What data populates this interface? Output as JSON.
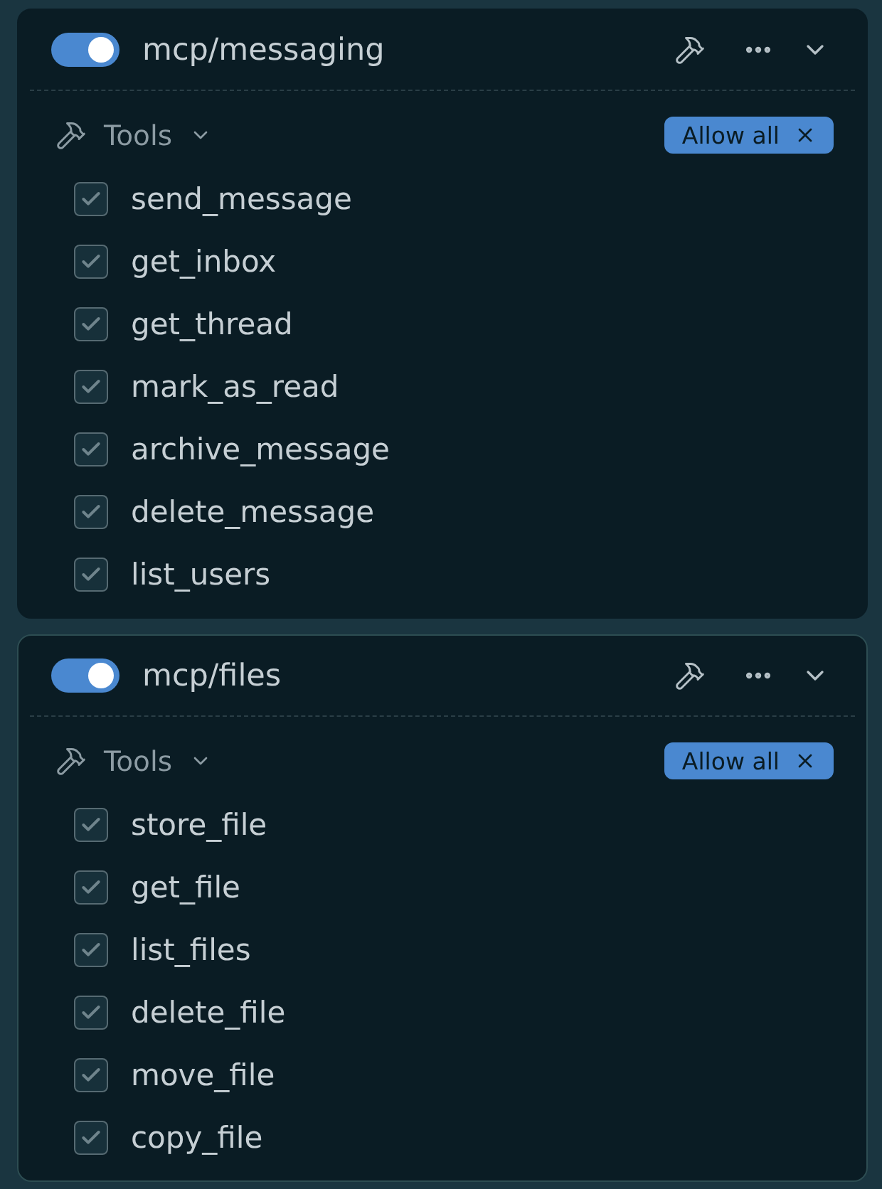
{
  "servers": [
    {
      "name": "mcp/messaging",
      "enabled": true,
      "highlighted": false,
      "expanded": true,
      "tools_label": "Tools",
      "tools_expanded": true,
      "allow_all": "Allow all",
      "tools": [
        {
          "name": "send_message",
          "checked": true
        },
        {
          "name": "get_inbox",
          "checked": true
        },
        {
          "name": "get_thread",
          "checked": true
        },
        {
          "name": "mark_as_read",
          "checked": true
        },
        {
          "name": "archive_message",
          "checked": true
        },
        {
          "name": "delete_message",
          "checked": true
        },
        {
          "name": "list_users",
          "checked": true
        }
      ]
    },
    {
      "name": "mcp/files",
      "enabled": true,
      "highlighted": true,
      "expanded": true,
      "tools_label": "Tools",
      "tools_expanded": true,
      "allow_all": "Allow all",
      "tools": [
        {
          "name": "store_file",
          "checked": true
        },
        {
          "name": "get_file",
          "checked": true
        },
        {
          "name": "list_files",
          "checked": true
        },
        {
          "name": "delete_file",
          "checked": true
        },
        {
          "name": "move_file",
          "checked": true
        },
        {
          "name": "copy_file",
          "checked": true
        }
      ]
    }
  ]
}
